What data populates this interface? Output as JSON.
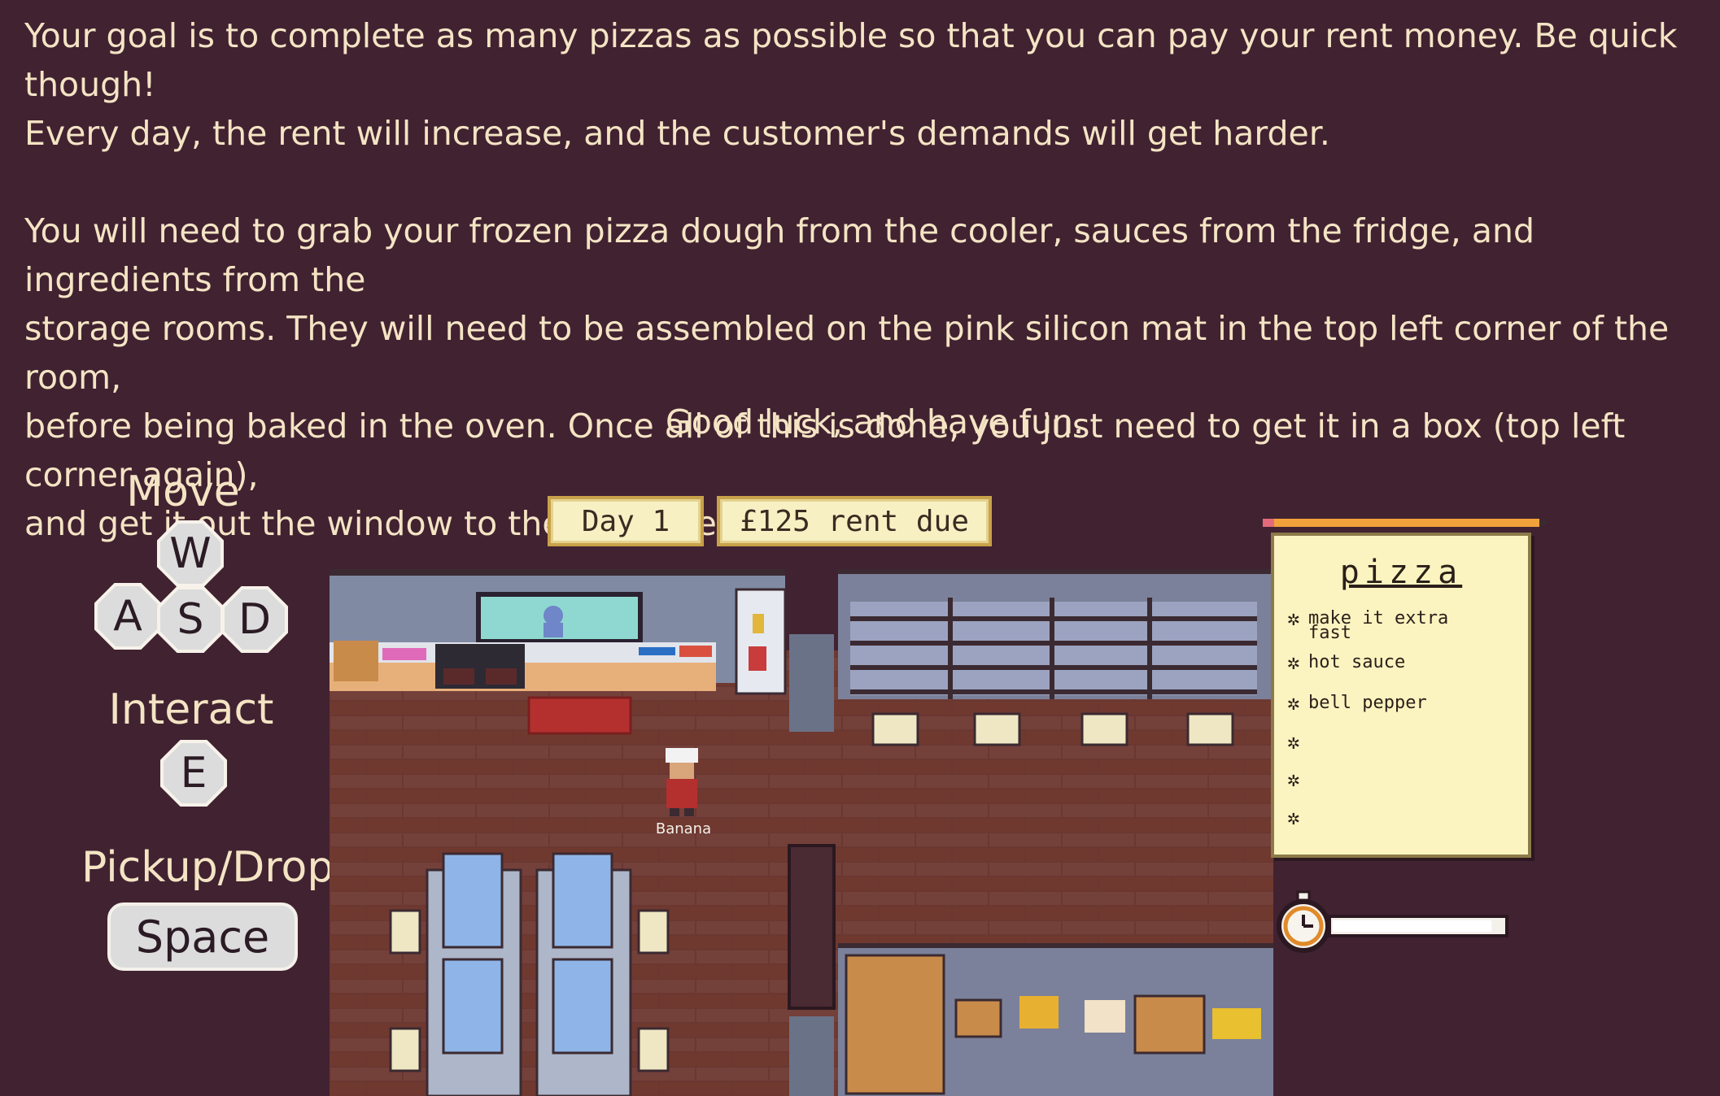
{
  "intro": {
    "p1_line1": "Your goal is to complete as many pizzas as possible so that you can pay your rent money. Be quick though!",
    "p1_line2": "Every day, the rent will increase, and the customer's demands will get harder.",
    "p2_line1": "You will need to grab your frozen pizza dough from the cooler, sauces from the fridge, and ingredients from the",
    "p2_line2": "storage rooms. They will need to be assembled on the pink silicon mat in the top left corner of the room,",
    "p2_line3": "before being baked in the oven. Once all of this is done, you just need to get it in a box (top left corner again),",
    "p2_line4": "and get it out the window to the customer!",
    "good_luck": "Good luck, and have fun."
  },
  "controls": {
    "move_title": "Move",
    "keys_move": [
      "W",
      "A",
      "S",
      "D"
    ],
    "interact_title": "Interact",
    "interact_key": "E",
    "pickup_title": "Pickup/Drop",
    "pickup_key": "Space"
  },
  "hud": {
    "day": "Day 1",
    "rent": "£125 rent due"
  },
  "player": {
    "name": "Banana"
  },
  "order": {
    "title": "pizza",
    "items": [
      "make it extra",
      "fast",
      "hot sauce",
      "bell pepper",
      "",
      "",
      ""
    ]
  },
  "timer": {
    "remaining_fraction": 0.93
  },
  "colors": {
    "background": "#412231",
    "text": "#f4e4c4",
    "floor": "#6e3a34",
    "wall": "#7a7f99",
    "notepad": "#fbf4c0"
  }
}
